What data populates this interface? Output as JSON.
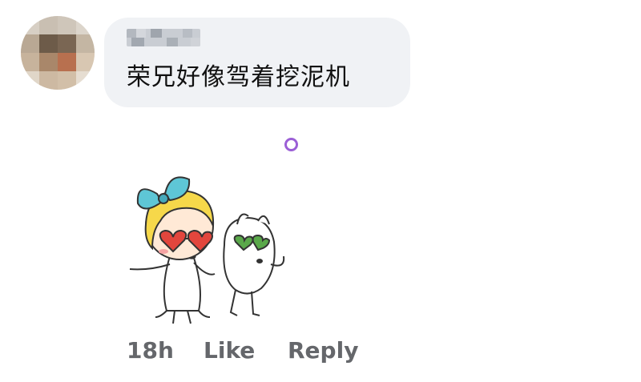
{
  "comment": {
    "author": "",
    "text": "荣兄好像驾着挖泥机",
    "timestamp": "18h",
    "like_label": "Like",
    "reply_label": "Reply"
  },
  "colors": {
    "bubble": "#f0f2f5",
    "action_text": "#65676b",
    "indicator": "#9b5fd6"
  }
}
